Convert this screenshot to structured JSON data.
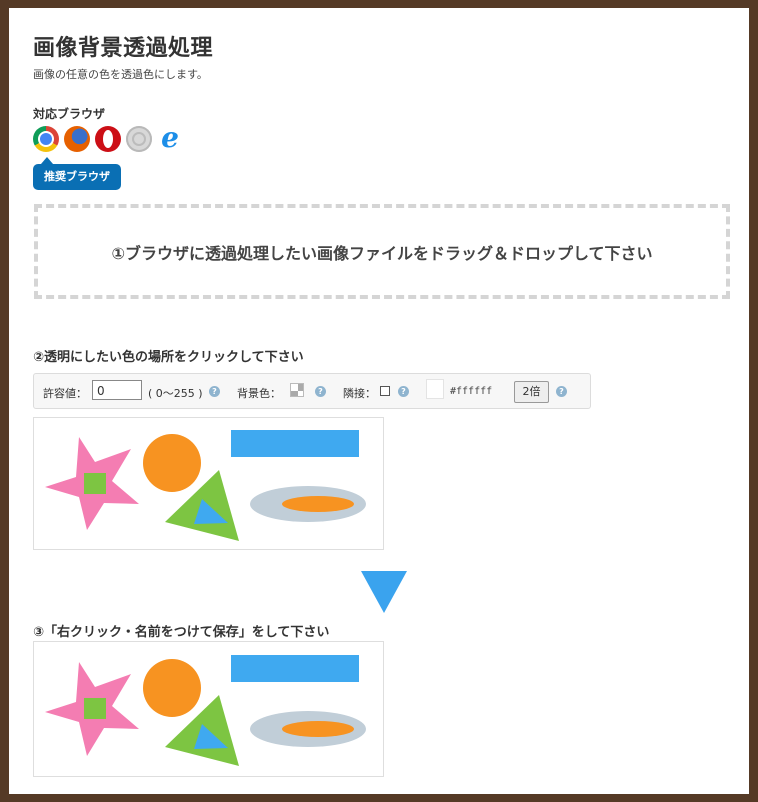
{
  "header": {
    "title": "画像背景透過処理",
    "subtitle": "画像の任意の色を透過色にします。"
  },
  "browsers": {
    "label": "対応ブラウザ",
    "icons": [
      "chrome-icon",
      "firefox-icon",
      "opera-icon",
      "safari-icon",
      "ie-icon"
    ],
    "recommended_label": "推奨ブラウザ"
  },
  "dropzone": {
    "text": "①ブラウザに透過処理したい画像ファイルをドラッグ＆ドロップして下さい"
  },
  "step2": {
    "title": "②透明にしたい色の場所をクリックして下さい",
    "tolerance_label": "許容値：",
    "tolerance_value": "0",
    "tolerance_range": "( 0〜255 )",
    "help_glyph": "?",
    "background_label": "背景色：",
    "adjacent_label": "隣接：",
    "color_hex": "#ffffff",
    "zoom_label": "2倍"
  },
  "step3": {
    "title": "③「右クリック・名前をつけて保存」をして下さい"
  },
  "colors": {
    "frame": "#553a26",
    "recommend_badge": "#0a6fb4",
    "arrow": "#3aa3ee",
    "star": "#f47db2",
    "green": "#7dc542",
    "orange": "#f79321",
    "blue": "#3fa9f0",
    "ellipse": "#c1ced8"
  }
}
